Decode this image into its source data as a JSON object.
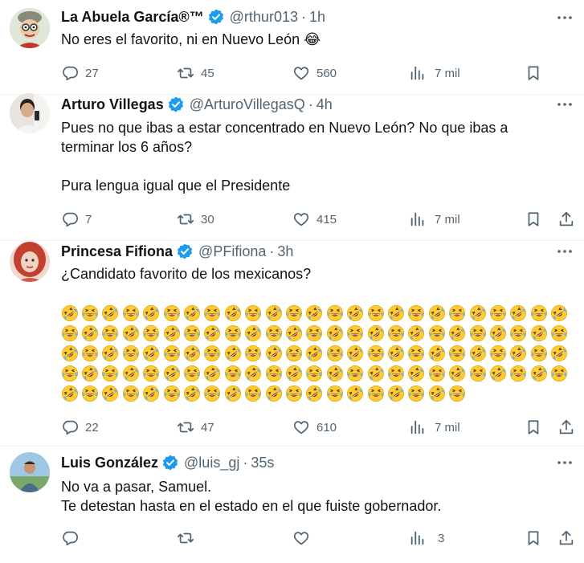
{
  "colors": {
    "accent": "#1d9bf0",
    "text": "#0f1419",
    "muted": "#536471",
    "divider": "#eff3f4"
  },
  "tweets": [
    {
      "name": "La Abuela García®™",
      "handle": "@rthur013",
      "sep": "·",
      "time": "1h",
      "text": "No eres el favorito, ni en Nuevo León 😂",
      "replies": "27",
      "retweets": "45",
      "likes": "560",
      "views": "7 mil",
      "has_share": false
    },
    {
      "name": "Arturo Villegas",
      "handle": "@ArturoVillegasQ",
      "sep": "·",
      "time": "4h",
      "text": "Pues no que ibas a estar concentrado en Nuevo León? No que ibas a terminar los 6 años?\n\nPura lengua igual que el Presidente",
      "replies": "7",
      "retweets": "30",
      "likes": "415",
      "views": "7 mil",
      "has_share": true
    },
    {
      "name": "Princesa Fifiona",
      "handle": "@PFifiona",
      "sep": "·",
      "time": "3h",
      "text": "¿Candidato favorito de los mexicanos?",
      "emoji_rows": [
        25,
        25,
        25,
        25,
        20
      ],
      "replies": "22",
      "retweets": "47",
      "likes": "610",
      "views": "7 mil",
      "has_share": true
    },
    {
      "name": "Luis González",
      "handle": "@luis_gj",
      "sep": "·",
      "time": "35s",
      "text": "No va a pasar, Samuel.\nTe detestan hasta en el estado en el que fuiste gobernador.",
      "replies": "",
      "retweets": "",
      "likes": "",
      "views": "3",
      "has_share": true
    }
  ],
  "icons": {
    "reply": "reply-icon",
    "retweet": "retweet-icon",
    "like": "heart-icon",
    "views": "views-icon",
    "bookmark": "bookmark-icon",
    "share": "share-icon",
    "more": "more-icon",
    "verified": "verified-badge-icon",
    "emoji_a": "rolling-on-floor-laughing-emoji",
    "emoji_b": "tears-of-joy-emoji"
  }
}
